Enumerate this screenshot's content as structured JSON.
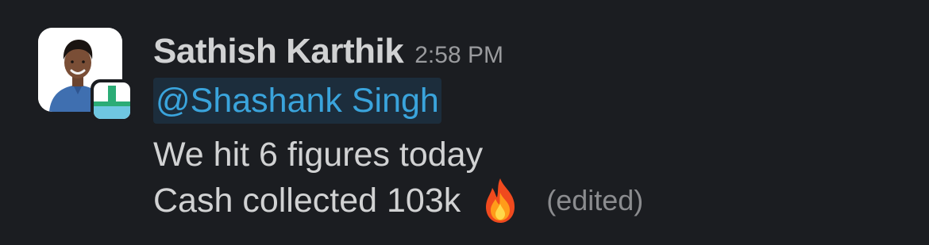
{
  "sender": {
    "name": "Sathish Karthik",
    "timestamp": "2:58 PM",
    "avatar_icon": "user-photo-avatar",
    "app_badge_icon": "app-badge-icon",
    "app_badge_colors": [
      "#ffffff",
      "#2bac76",
      "#6fc7e2"
    ]
  },
  "message": {
    "mention": "@Shashank Singh",
    "line1": "We hit 6 figures today",
    "line2": "Cash collected 103k",
    "emoji_icon": "fire-emoji-icon",
    "edited_label": "(edited)"
  },
  "colors": {
    "background": "#1b1d21",
    "text": "#d1d2d3",
    "mention_text": "#3aa4dc",
    "mention_bg": "#1c2d3c",
    "muted": "#9a9b9e"
  }
}
